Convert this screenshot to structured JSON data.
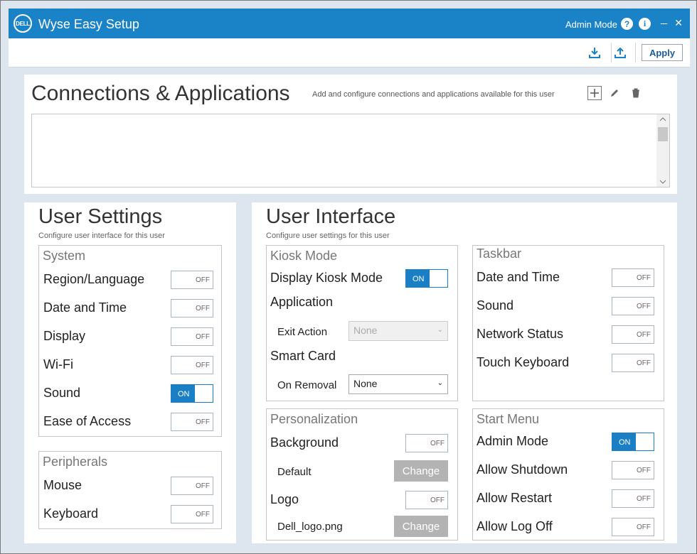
{
  "window": {
    "title": "Wyse Easy Setup",
    "logo_text": "DELL",
    "admin_mode_label": "Admin Mode",
    "help_icon_text": "?",
    "info_icon_text": "i",
    "minimize_glyph": "_",
    "close_glyph": "✕"
  },
  "toolbar": {
    "apply_label": "Apply"
  },
  "connections": {
    "title": "Connections & Applications",
    "description": "Add and configure connections and applications available for this user"
  },
  "user_settings": {
    "title": "User Settings",
    "subtitle": "Configure user interface for this user",
    "system": {
      "title": "System",
      "items": [
        {
          "label": "Region/Language",
          "state": "OFF"
        },
        {
          "label": "Date and Time",
          "state": "OFF"
        },
        {
          "label": "Display",
          "state": "OFF"
        },
        {
          "label": "Wi-Fi",
          "state": "OFF"
        },
        {
          "label": "Sound",
          "state": "ON"
        },
        {
          "label": "Ease of Access",
          "state": "OFF"
        }
      ]
    },
    "peripherals": {
      "title": "Peripherals",
      "items": [
        {
          "label": "Mouse",
          "state": "OFF"
        },
        {
          "label": "Keyboard",
          "state": "OFF"
        }
      ]
    }
  },
  "user_interface": {
    "title": "User Interface",
    "subtitle": "Configure user settings for this user",
    "kiosk": {
      "title": "Kiosk Mode",
      "display_kiosk_label": "Display Kiosk Mode",
      "display_kiosk_state": "ON",
      "application_label": "Application",
      "exit_action_label": "Exit Action",
      "exit_action_value": "None",
      "smart_card_label": "Smart Card",
      "on_removal_label": "On Removal",
      "on_removal_value": "None"
    },
    "taskbar": {
      "title": "Taskbar",
      "items": [
        {
          "label": "Date and Time",
          "state": "OFF"
        },
        {
          "label": "Sound",
          "state": "OFF"
        },
        {
          "label": "Network Status",
          "state": "OFF"
        },
        {
          "label": "Touch Keyboard",
          "state": "OFF"
        }
      ]
    },
    "personalization": {
      "title": "Personalization",
      "background_label": "Background",
      "background_state": "OFF",
      "background_file": "Default",
      "logo_label": "Logo",
      "logo_state": "OFF",
      "logo_file": "Dell_logo.png",
      "change_label": "Change"
    },
    "start_menu": {
      "title": "Start Menu",
      "items": [
        {
          "label": "Admin Mode",
          "state": "ON"
        },
        {
          "label": "Allow Shutdown",
          "state": "OFF"
        },
        {
          "label": "Allow Restart",
          "state": "OFF"
        },
        {
          "label": "Allow Log Off",
          "state": "OFF"
        }
      ]
    }
  },
  "colors": {
    "accent": "#1a82c6",
    "toggle_on": "#1a7fc4",
    "change_button": "#b3b3b3"
  }
}
